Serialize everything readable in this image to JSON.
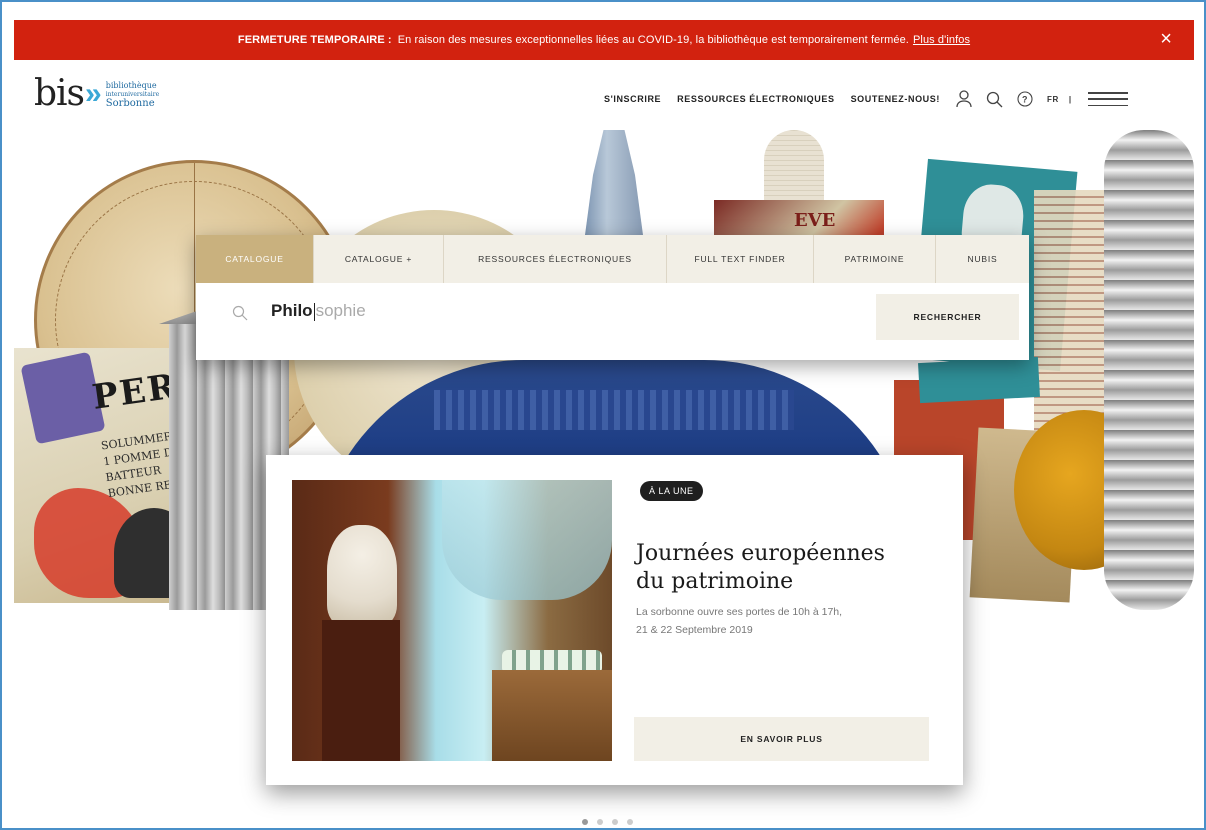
{
  "alert": {
    "label": "FERMETURE TEMPORAIRE :",
    "message": "En raison des mesures exceptionnelles liées au COVID-19, la bibliothèque est temporairement fermée.",
    "link": "Plus d'infos",
    "close": "×"
  },
  "logo": {
    "bis": "bis",
    "chevrons": "»",
    "line1": "bibliothèque",
    "line2": "interuniversitaire",
    "line3": "Sorbonne"
  },
  "nav": {
    "items": [
      "S'INSCRIRE",
      "RESSOURCES ÉLECTRONIQUES",
      "SOUTENEZ-NOUS!"
    ],
    "lang": "FR",
    "lang_sep": "|"
  },
  "search": {
    "tabs": [
      "CATALOGUE",
      "CATALOGUE +",
      "RESSOURCES ÉLECTRONIQUES",
      "FULL TEXT FINDER",
      "PATRIMOINE",
      "NUBIS"
    ],
    "active_tab": 0,
    "typed": "Philo",
    "suggestion": "sophie",
    "button": "RECHERCHER"
  },
  "feature": {
    "badge": "À LA UNE",
    "title_line1": "Journées européennes",
    "title_line2": "du patrimoine",
    "desc_line1": "La sorbonne ouvre ses portes de 10h à 17h,",
    "desc_line2": "21 & 22 Septembre 2019",
    "button": "EN SAVOIR PLUS"
  },
  "collage_text": {
    "poster": "PERR",
    "poster_lines": [
      "SOLUMMERE",
      "1 POMME DE",
      "BATTEUR",
      "BONNE RECO"
    ],
    "book": "EVE"
  },
  "carousel": {
    "count": 4,
    "active": 0
  },
  "colors": {
    "alert": "#d2220f",
    "accent": "#c9b17e",
    "panel": "#f2efe6",
    "brand_blue": "#3ba8d6"
  }
}
